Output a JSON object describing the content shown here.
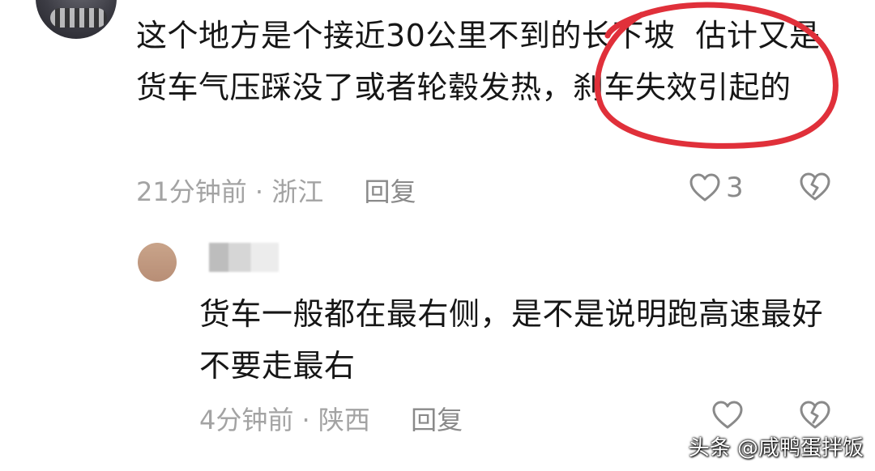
{
  "comment1": {
    "text": "这个地方是个接近30公里不到的长下坡  估计又是货车气压踩没了或者轮毂发热，刹车失效引起的",
    "time": "21分钟前",
    "location": "浙江",
    "reply_label": "回复",
    "like_count": "3"
  },
  "comment2": {
    "text": "货车一般都在最右侧，是不是说明跑高速最好不要走最右",
    "time": "4分钟前",
    "location": "陕西",
    "reply_label": "回复",
    "like_count": ""
  },
  "separator": " · ",
  "watermark": "头条 @咸鸭蛋拌饭",
  "icons": {
    "like": "heart-outline-icon",
    "dislike": "broken-heart-icon"
  },
  "colors": {
    "annotation_circle": "#e0303a",
    "meta_text": "#a3a3a3"
  }
}
